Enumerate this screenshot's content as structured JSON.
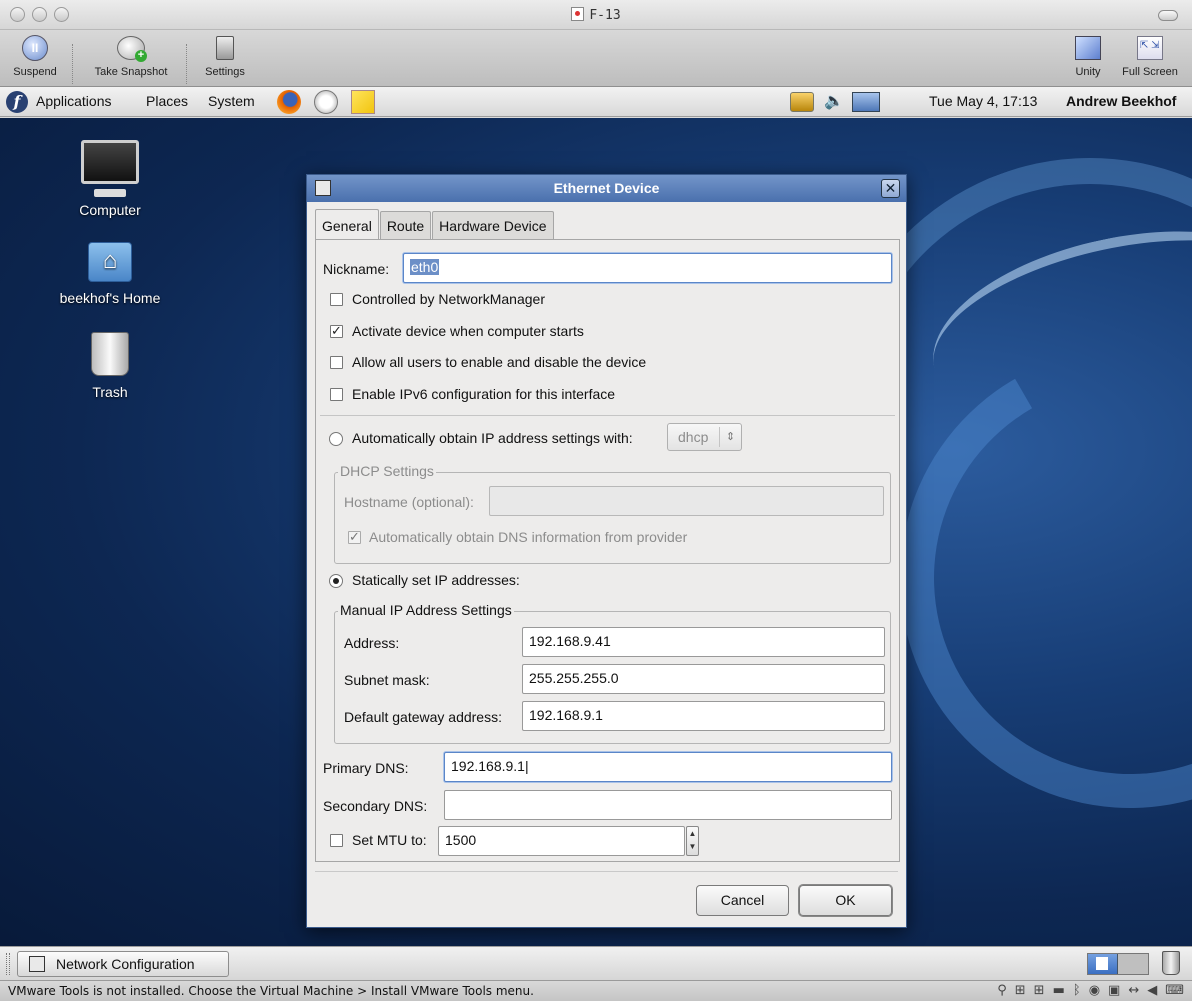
{
  "vmware": {
    "window_title": "F-13",
    "toolbar": {
      "suspend": "Suspend",
      "take_snapshot": "Take Snapshot",
      "settings": "Settings",
      "unity": "Unity",
      "full_screen": "Full Screen"
    },
    "status_text": "VMware Tools is not installed. Choose the Virtual Machine > Install VMware Tools menu."
  },
  "gnome_panel": {
    "menus": [
      "Applications",
      "Places",
      "System"
    ],
    "clock": "Tue May  4, 17:13",
    "user": "Andrew Beekhof"
  },
  "desktop": {
    "icons": [
      "Computer",
      "beekhof's Home",
      "Trash"
    ]
  },
  "dialog": {
    "title": "Ethernet Device",
    "tabs": [
      "General",
      "Route",
      "Hardware Device"
    ],
    "nickname_label": "Nickname:",
    "nickname_value": "eth0",
    "checkboxes": [
      {
        "label": "Controlled by NetworkManager",
        "checked": false
      },
      {
        "label": "Activate device when computer starts",
        "checked": true
      },
      {
        "label": "Allow all users to enable and disable the device",
        "checked": false
      },
      {
        "label": "Enable IPv6 configuration for this interface",
        "checked": false
      }
    ],
    "auto_ip_label": "Automatically obtain IP address settings with:",
    "auto_ip_method": "dhcp",
    "dhcp_frame_title": "DHCP Settings",
    "hostname_label": "Hostname (optional):",
    "hostname_value": "",
    "auto_dns_label": "Automatically obtain DNS information from provider",
    "static_label": "Statically set IP addresses:",
    "manual_frame_title": "Manual IP Address Settings",
    "address_label": "Address:",
    "address_value": "192.168.9.41",
    "subnet_label": "Subnet mask:",
    "subnet_value": "255.255.255.0",
    "gateway_label": "Default gateway address:",
    "gateway_value": "192.168.9.1",
    "primary_dns_label": "Primary DNS:",
    "primary_dns_value": "192.168.9.1",
    "secondary_dns_label": "Secondary DNS:",
    "secondary_dns_value": "",
    "mtu_label": "Set MTU to:",
    "mtu_value": "1500",
    "cancel": "Cancel",
    "ok": "OK"
  },
  "taskbar": {
    "window_button": "Network Configuration"
  }
}
